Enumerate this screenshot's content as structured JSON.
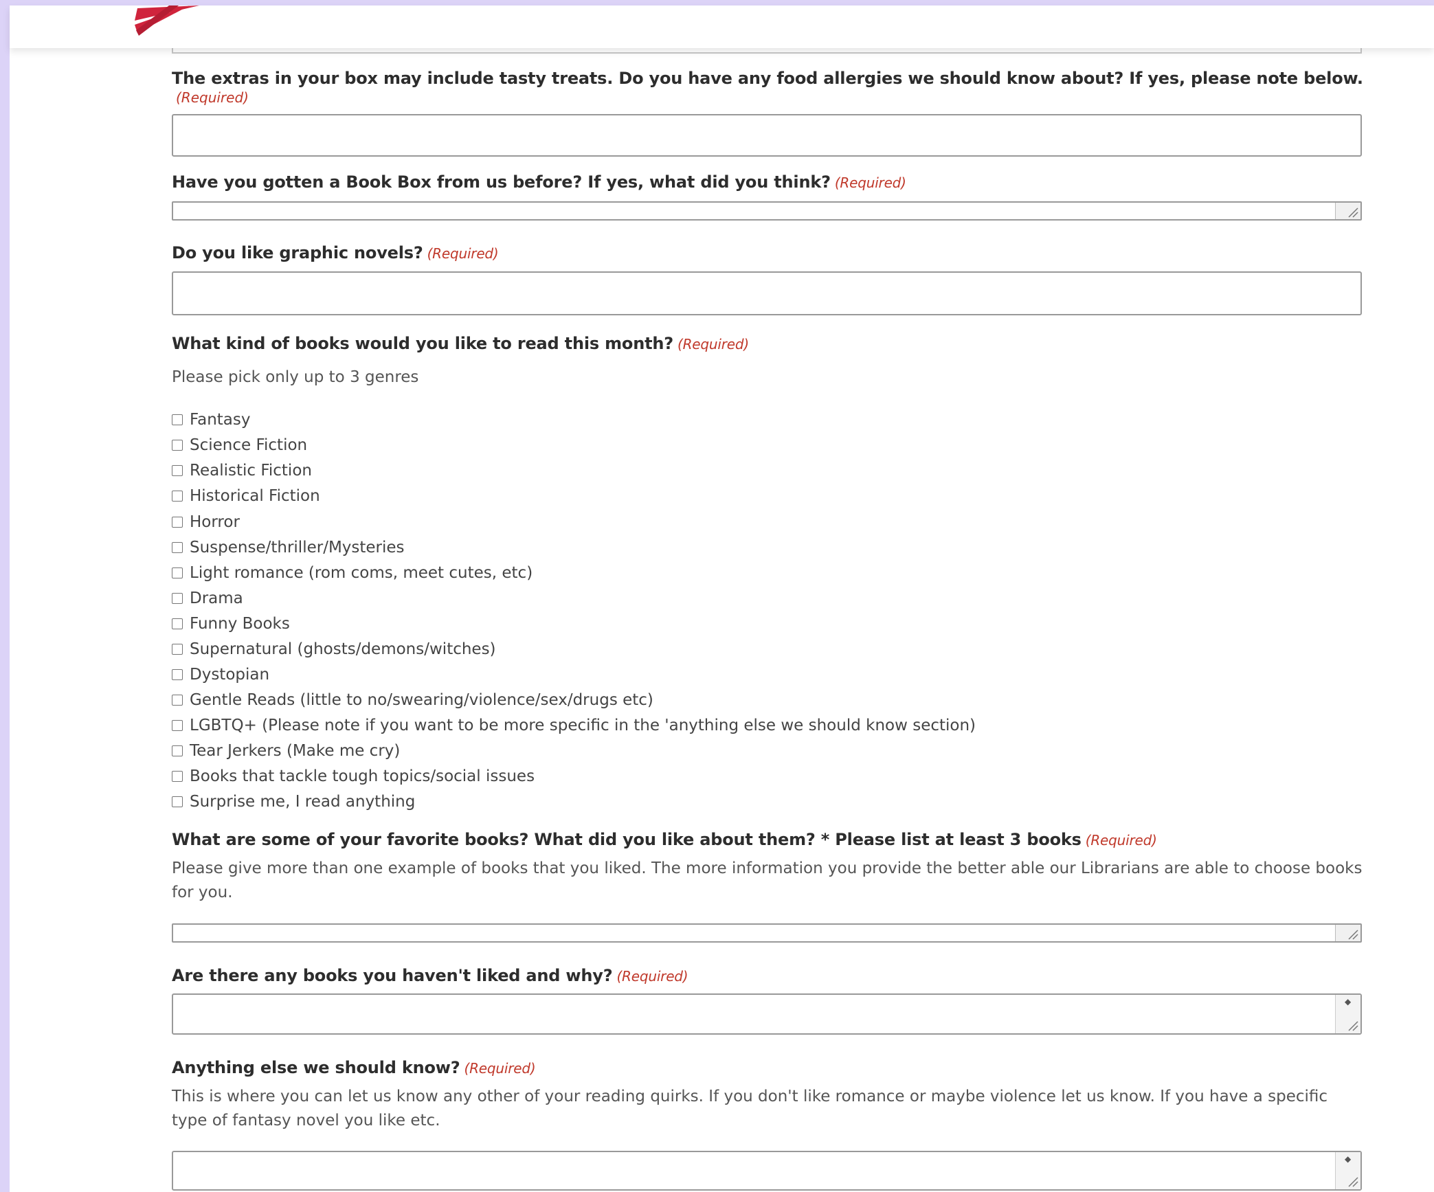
{
  "colors": {
    "frame": "#dcd3f7",
    "required": "#c0392b",
    "logo_red": "#d0243c"
  },
  "required_marker": "(Required)",
  "questions": {
    "allergies": {
      "label": "The extras in your box may include tasty treats. Do you have any food allergies we should know about? If yes, please note below.",
      "value": ""
    },
    "previous_box": {
      "label": "Have you gotten a Book Box from us before? If yes, what did you think?",
      "value": ""
    },
    "graphic_novels": {
      "label": "Do you like graphic novels?",
      "value": ""
    },
    "genres": {
      "label": "What kind of books would you like to read this month?",
      "description": "Please pick only up to 3 genres",
      "options": [
        "Fantasy",
        "Science Fiction",
        "Realistic Fiction",
        "Historical Fiction",
        "Horror",
        "Suspense/thriller/Mysteries",
        "Light romance (rom coms, meet cutes, etc)",
        "Drama",
        "Funny Books",
        "Supernatural (ghosts/demons/witches)",
        "Dystopian",
        "Gentle Reads (little to no/swearing/violence/sex/drugs etc)",
        "LGBTQ+ (Please note if you want to be more specific in the 'anything else we should know section)",
        "Tear Jerkers (Make me cry)",
        "Books that tackle tough topics/social issues",
        "Surprise me, I read anything"
      ]
    },
    "favorite_books": {
      "label": "What are some of your favorite books? What did you like about them? * Please list at least 3 books",
      "description": "Please give more than one example of books that you liked. The more information you provide the better able our Librarians are able to choose books for you.",
      "value": ""
    },
    "disliked_books": {
      "label": "Are there any books you haven't liked and why?",
      "value": ""
    },
    "anything_else": {
      "label": "Anything else we should know?",
      "description": "This is where you can let us know any other of your reading quirks. If you don't like romance or maybe violence let us know. If you have a specific type of fantasy novel you like etc.",
      "value": ""
    }
  }
}
